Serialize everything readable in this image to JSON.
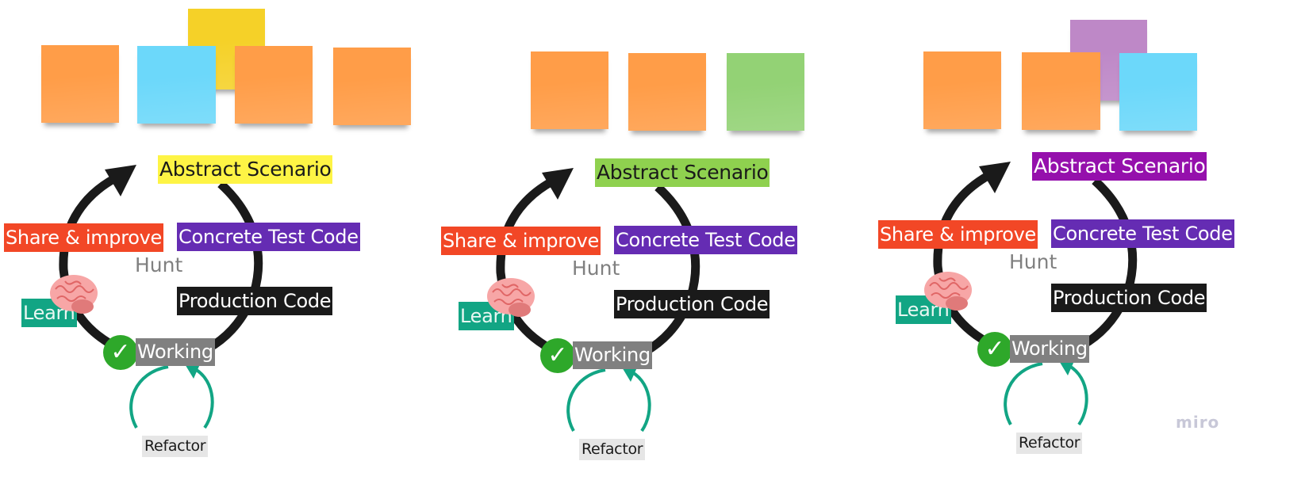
{
  "board": {
    "watermark": "miro",
    "panels": [
      {
        "id": "panel-1",
        "stickies": [
          {
            "color": "#f5d128",
            "note": "yellow"
          },
          {
            "color": "#ff9d48",
            "note": "orange"
          },
          {
            "color": "#6cd8fa",
            "note": "blue"
          },
          {
            "color": "#ff9d48",
            "note": "orange"
          },
          {
            "color": "#ff9d48",
            "note": "orange"
          }
        ],
        "labels": {
          "abstract": "Abstract Scenario",
          "share": "Share & improve",
          "concrete": "Concrete Test Code",
          "hunt": "Hunt",
          "production": "Production Code",
          "learn": "Learn",
          "working": "Working",
          "refactor": "Refactor"
        },
        "abstract_bg": "#fef445",
        "abstract_fg": "#1a1a1a"
      },
      {
        "id": "panel-2",
        "stickies": [
          {
            "color": "#ff9d48",
            "note": "orange"
          },
          {
            "color": "#ff9d48",
            "note": "orange"
          },
          {
            "color": "#93d275",
            "note": "green"
          }
        ],
        "labels": {
          "abstract": "Abstract Scenario",
          "share": "Share & improve",
          "concrete": "Concrete Test Code",
          "hunt": "Hunt",
          "production": "Production Code",
          "learn": "Learn",
          "working": "Working",
          "refactor": "Refactor"
        },
        "abstract_bg": "#8fd14f",
        "abstract_fg": "#1a1a1a"
      },
      {
        "id": "panel-3",
        "stickies": [
          {
            "color": "#be88c7",
            "note": "violet"
          },
          {
            "color": "#ff9d48",
            "note": "orange"
          },
          {
            "color": "#ff9d48",
            "note": "orange"
          },
          {
            "color": "#6cd8fa",
            "note": "blue"
          }
        ],
        "labels": {
          "abstract": "Abstract Scenario",
          "share": "Share & improve",
          "concrete": "Concrete Test Code",
          "hunt": "Hunt",
          "production": "Production Code",
          "learn": "Learn",
          "working": "Working",
          "refactor": "Refactor"
        },
        "abstract_bg": "#9510ac",
        "abstract_fg": "#ffffff"
      }
    ],
    "icons": {
      "check": "✓",
      "brain": "brain-icon",
      "cycle_arrow": "arrow-icon",
      "refactor_loop": "loop-arrow-icon"
    },
    "colors": {
      "cycle_stroke": "#1a1a1a",
      "refactor_stroke": "#12a584",
      "check_bg": "#2ea82a"
    }
  }
}
